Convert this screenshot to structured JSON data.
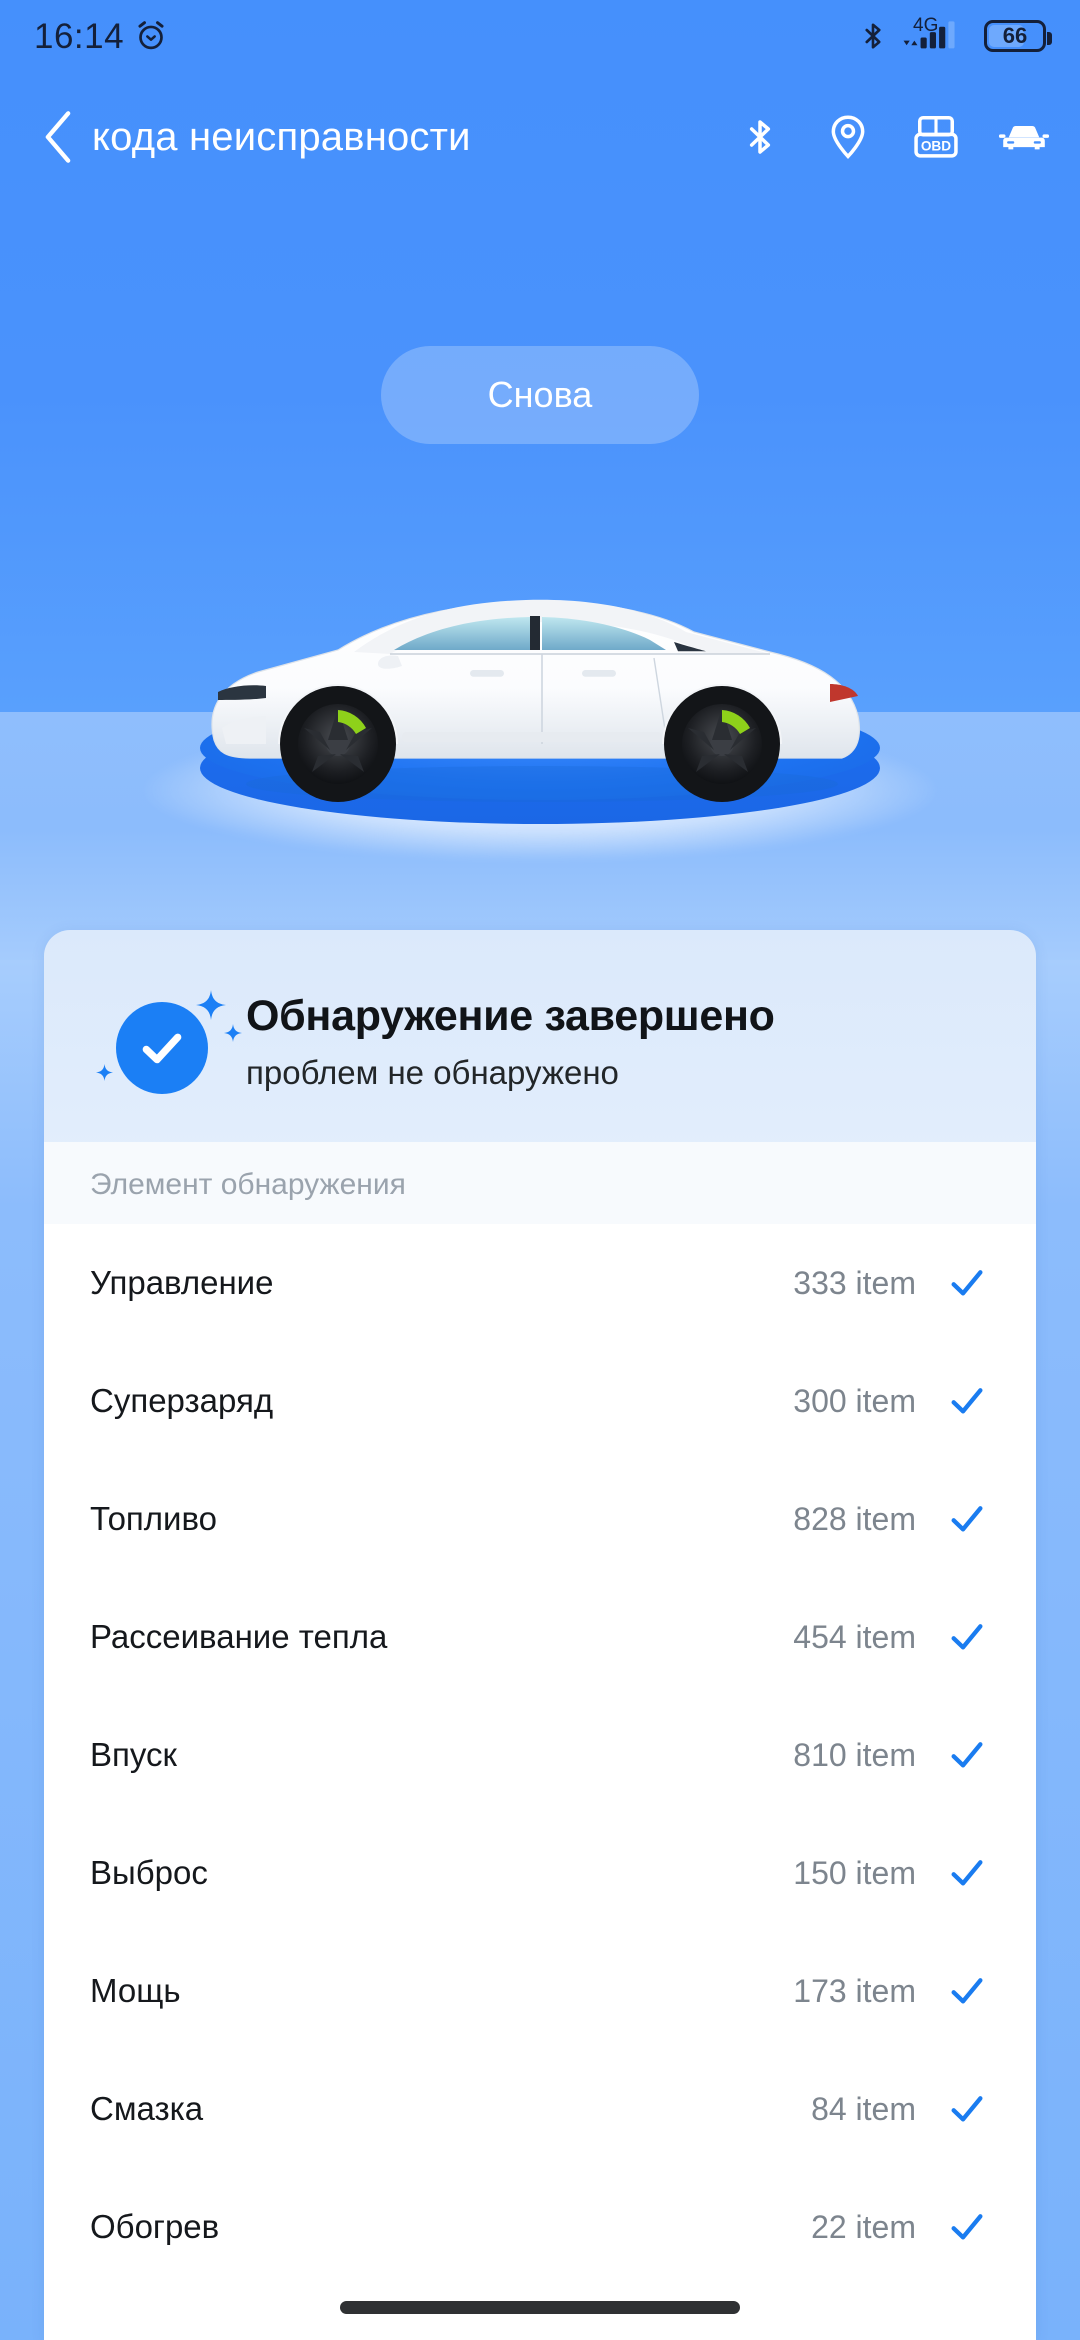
{
  "status_bar": {
    "time": "16:14",
    "alarm_icon": "alarm-clock-icon",
    "bluetooth_icon": "bluetooth-icon",
    "network_label": "4G",
    "signal_icon": "signal-bars-icon",
    "battery_level": "66"
  },
  "header": {
    "back_icon": "chevron-left-icon",
    "title": "кода неисправности",
    "actions": [
      {
        "name": "bluetooth-icon",
        "label": "Bluetooth"
      },
      {
        "name": "location-pin-icon",
        "label": "Location"
      },
      {
        "name": "obd-connector-icon",
        "label": "OBD"
      },
      {
        "name": "car-front-icon",
        "label": "Car"
      }
    ]
  },
  "hero": {
    "again_button": "Снова",
    "vehicle_image": "white-sedan-on-blue-podium"
  },
  "result": {
    "status_icon": "check-circle-icon",
    "title": "Обнаружение завершено",
    "subtitle": "проблем не обнаружено"
  },
  "table": {
    "column_header": "Элемент обнаружения",
    "unit": "item",
    "row_status_icon": "check-mark-icon",
    "rows": [
      {
        "name": "Управление",
        "count": "333 item"
      },
      {
        "name": "Суперзаряд",
        "count": "300 item"
      },
      {
        "name": "Топливо",
        "count": "828 item"
      },
      {
        "name": "Рассеивание тепла",
        "count": "454 item"
      },
      {
        "name": "Впуск",
        "count": "810 item"
      },
      {
        "name": "Выброс",
        "count": "150 item"
      },
      {
        "name": "Мощь",
        "count": "173 item"
      },
      {
        "name": "Смазка",
        "count": "84 item"
      },
      {
        "name": "Обогрев",
        "count": "22 item"
      }
    ]
  },
  "colors": {
    "sky_blue": "#4590fc",
    "floor_blue": "#8cbcfc",
    "accent_blue": "#1b7ff5",
    "check_blue": "#1a7cf0",
    "podium_blue": "#1e73f2",
    "card_white": "#ffffff",
    "muted_text": "#7d858e",
    "gesture_bar": "#2f3133"
  },
  "system": {
    "gesture_bar": "home-indicator"
  }
}
